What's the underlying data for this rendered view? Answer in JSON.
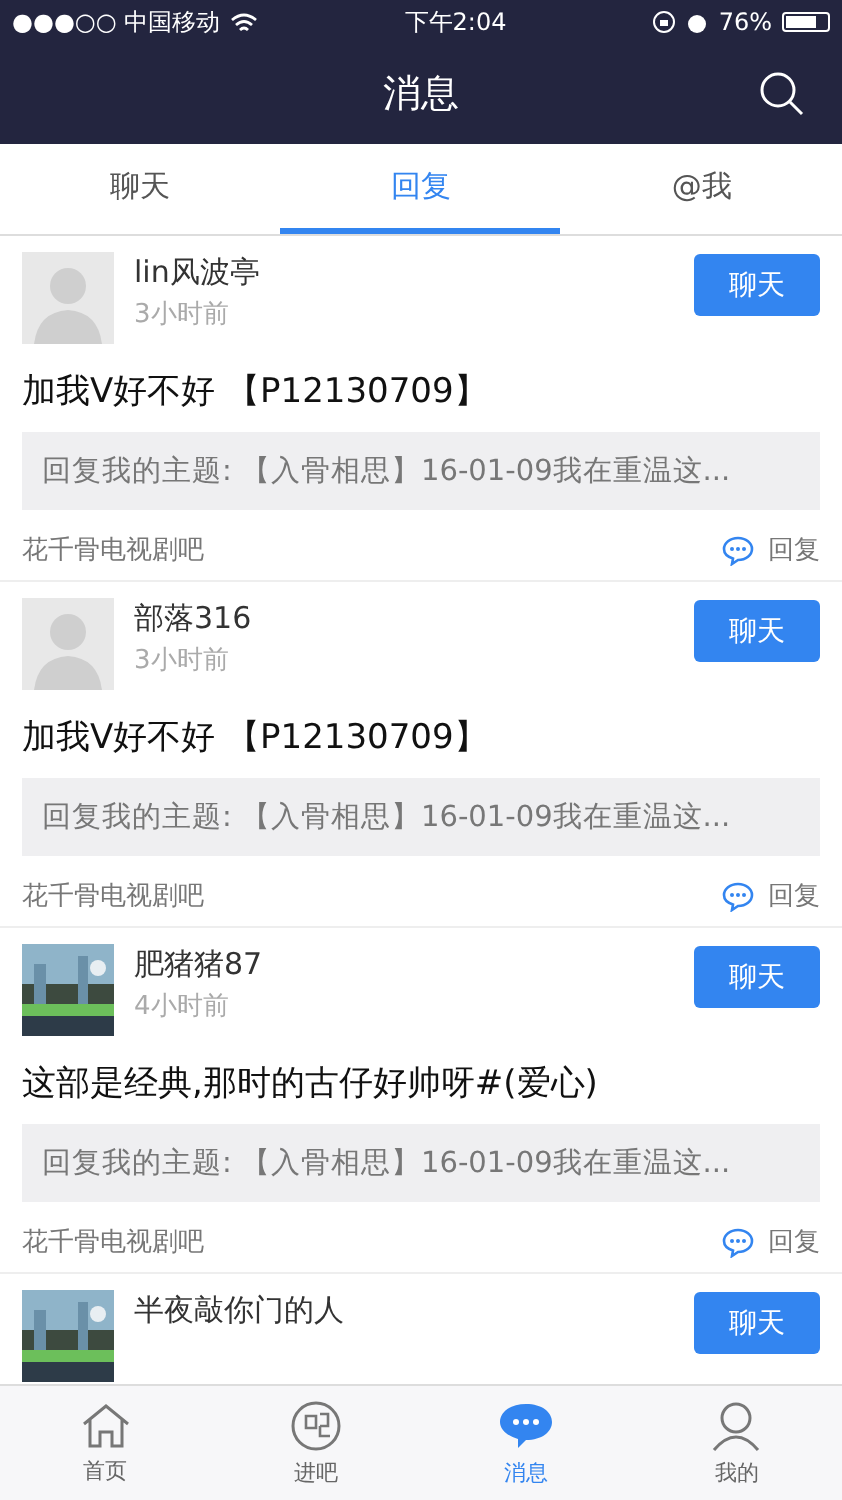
{
  "status_bar": {
    "carrier": "●●●○○ 中国移动",
    "time": "下午2:04",
    "battery": "76%"
  },
  "nav": {
    "title": "消息"
  },
  "tabs": [
    {
      "label": "聊天",
      "selected": false
    },
    {
      "label": "回复",
      "selected": true
    },
    {
      "label": "@我",
      "selected": false
    }
  ],
  "replies": [
    {
      "user": "lin风波亭",
      "kind": "silhouette",
      "time": "3小时前",
      "chat_button": "聊天",
      "content": "加我V好不好 【P12130709】",
      "quote": "回复我的主题: 【入骨相思】16-01-09我在重温这...",
      "forum": "花千骨电视剧吧",
      "reply_label": "回复"
    },
    {
      "user": "部落316",
      "kind": "silhouette",
      "time": "3小时前",
      "chat_button": "聊天",
      "content": "加我V好不好 【P12130709】",
      "quote": "回复我的主题: 【入骨相思】16-01-09我在重温这...",
      "forum": "花千骨电视剧吧",
      "reply_label": "回复"
    },
    {
      "user": "肥猪猪87",
      "kind": "picture",
      "time": "4小时前",
      "chat_button": "聊天",
      "content": "这部是经典,那时的古仔好帅呀#(爱心)",
      "quote": "回复我的主题: 【入骨相思】16-01-09我在重温这...",
      "forum": "花千骨电视剧吧",
      "reply_label": "回复"
    },
    {
      "user": "半夜敲你门的人",
      "kind": "picture",
      "chat_button": "聊天"
    }
  ],
  "tab_bar": [
    {
      "label": "首页",
      "selected": false
    },
    {
      "label": "进吧",
      "selected": false
    },
    {
      "label": "消息",
      "selected": true
    },
    {
      "label": "我的",
      "selected": false
    }
  ]
}
